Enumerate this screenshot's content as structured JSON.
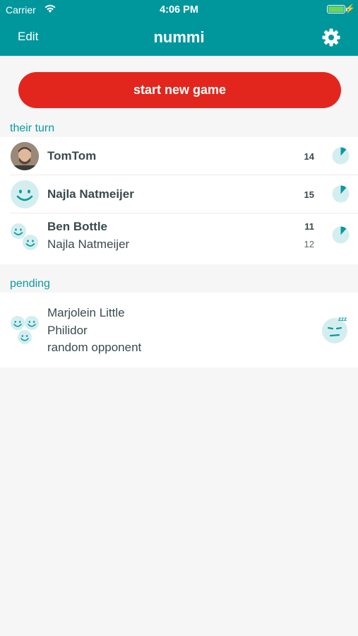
{
  "status": {
    "carrier": "Carrier",
    "time": "4:06 PM"
  },
  "nav": {
    "edit": "Edit",
    "title": "nummi"
  },
  "start_button": "start new game",
  "sections": {
    "their_turn": "their turn",
    "pending": "pending"
  },
  "their_turn_games": [
    {
      "players": [
        {
          "name": "TomTom",
          "score": "14"
        }
      ]
    },
    {
      "players": [
        {
          "name": "Najla Natmeijer",
          "score": "15"
        }
      ]
    },
    {
      "players": [
        {
          "name": "Ben Bottle",
          "score": "11"
        },
        {
          "name": "Najla Natmeijer",
          "score": "12"
        }
      ]
    }
  ],
  "pending_games": [
    {
      "players": [
        "Marjolein Little",
        "Philidor",
        "random opponent"
      ]
    }
  ],
  "colors": {
    "accent": "#00979c",
    "button": "#e3261d",
    "icon_fill": "#d4eeef",
    "icon_stroke": "#0a9aa0"
  },
  "icons": [
    "wifi-icon",
    "battery-icon",
    "gear-icon",
    "smiley-icon",
    "timer-icon",
    "sleeping-face-icon"
  ]
}
